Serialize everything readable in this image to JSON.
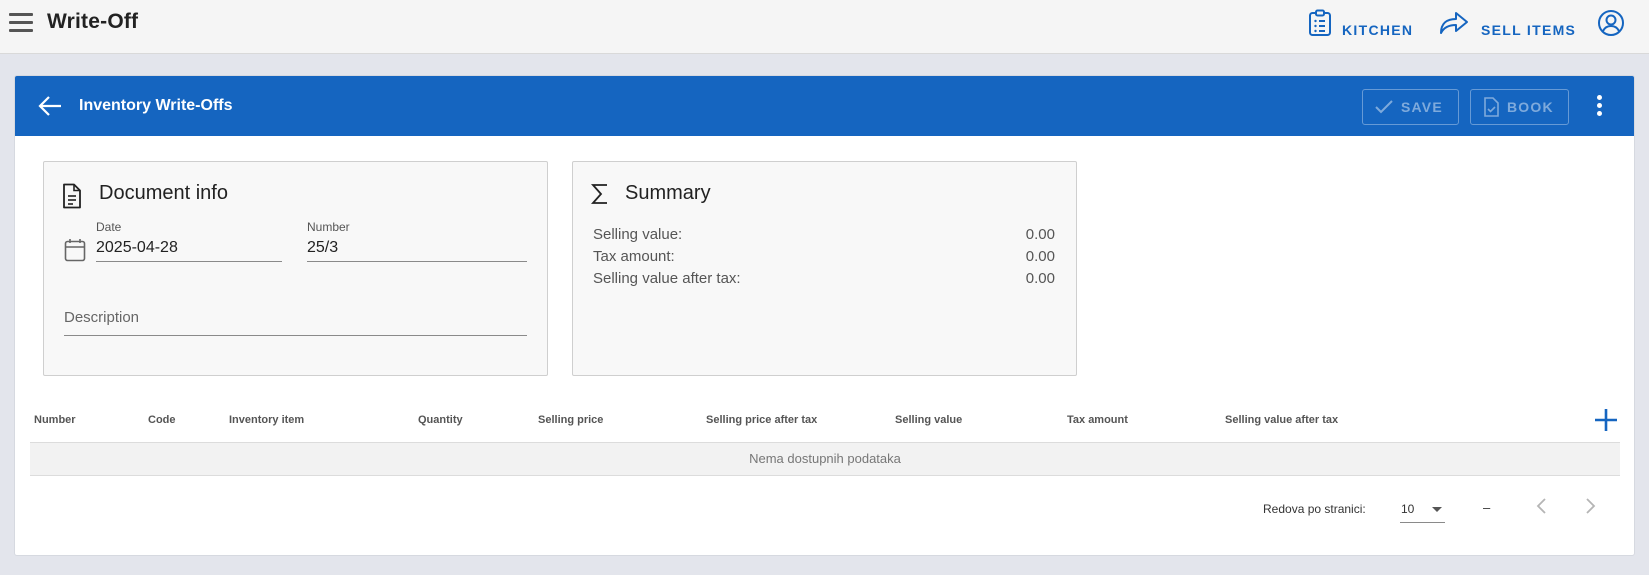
{
  "app": {
    "title": "Write-Off"
  },
  "topbar": {
    "kitchen_label": "KITCHEN",
    "sell_label": "SELL ITEMS"
  },
  "header": {
    "title": "Inventory Write-Offs",
    "save_label": "SAVE",
    "book_label": "BOOK"
  },
  "document_info": {
    "title": "Document info",
    "date_label": "Date",
    "date_value": "2025-04-28",
    "number_label": "Number",
    "number_value": "25/3",
    "description_label": "Description"
  },
  "summary": {
    "title": "Summary",
    "rows": [
      {
        "label": "Selling value:",
        "value": "0.00"
      },
      {
        "label": "Tax amount:",
        "value": "0.00"
      },
      {
        "label": "Selling value after tax:",
        "value": "0.00"
      }
    ]
  },
  "table": {
    "columns": [
      "Number",
      "Code",
      "Inventory item",
      "Quantity",
      "Selling price",
      "Selling price after tax",
      "Selling value",
      "Tax amount",
      "Selling value after tax"
    ],
    "empty_text": "Nema dostupnih podataka"
  },
  "pagination": {
    "rows_per_page_label": "Redova po stranici:",
    "rows_per_page_value": "10",
    "range_text": "–"
  },
  "colors": {
    "primary": "#1565c0",
    "topbar_bg": "#f5f5f5",
    "page_bg": "#e3e5ec"
  }
}
